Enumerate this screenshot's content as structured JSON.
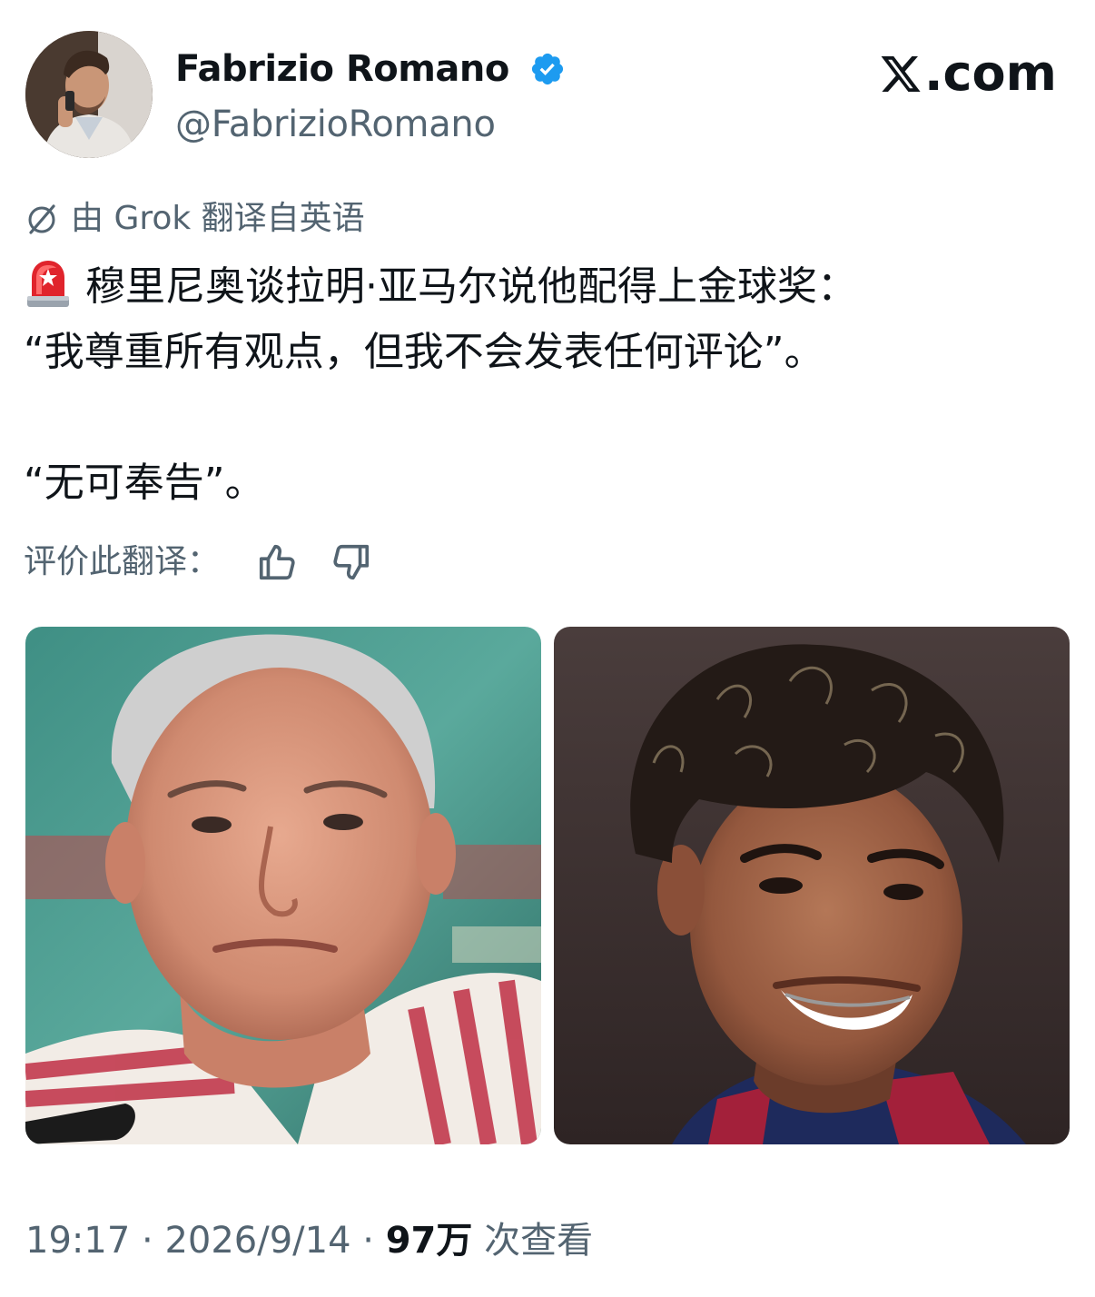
{
  "author": {
    "display_name": "Fabrizio Romano",
    "handle": "@FabrizioRomano",
    "verified_icon": "verified-badge-icon",
    "avatar_icon": "avatar"
  },
  "brand": {
    "label": ".com",
    "icon": "x-logo-icon"
  },
  "translation": {
    "notice": "由 Grok 翻译自英语",
    "icon": "grok-icon"
  },
  "tweet": {
    "emoji": "rotating-light-icon",
    "line1": "穆里尼奥谈拉明·亚马尔说他配得上金球奖：",
    "line2": "“我尊重所有观点，但我不会发表任何评论”。",
    "line3": "“无可奉告”。"
  },
  "rate": {
    "label": "评价此翻译：",
    "like_icon": "thumbs-up-icon",
    "dislike_icon": "thumbs-down-icon"
  },
  "media": [
    {
      "name": "media-photo-left"
    },
    {
      "name": "media-photo-right"
    }
  ],
  "footer": {
    "time": "19:17",
    "sep1": " · ",
    "date": "2026/9/14",
    "sep2": " · ",
    "views_count": "97万",
    "views_label": " 次查看"
  },
  "colors": {
    "text": "#0f1419",
    "secondary": "#536471",
    "verified": "#1d9bf0",
    "siren": "#e0242c"
  }
}
